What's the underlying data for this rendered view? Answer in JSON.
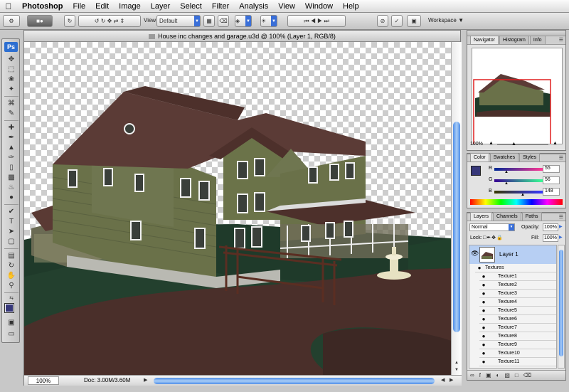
{
  "menubar": {
    "app_name": "Photoshop",
    "items": [
      "File",
      "Edit",
      "Image",
      "Layer",
      "Select",
      "Filter",
      "Analysis",
      "View",
      "Window",
      "Help"
    ]
  },
  "options_bar": {
    "view_label": "View:",
    "view_value": "Default",
    "workspace_label": "Workspace"
  },
  "tools": {
    "logo": "Ps",
    "foreground_color": "#37387a"
  },
  "document": {
    "title": "House inc changes and garage.u3d @ 100% (Layer 1, RGB/8)",
    "zoom": "100%",
    "doc_size": "Doc: 3.00M/3.60M"
  },
  "navigator": {
    "tabs": [
      "Navigator",
      "Histogram",
      "Info"
    ],
    "zoom": "100%"
  },
  "color_panel": {
    "tabs": [
      "Color",
      "Swatches",
      "Styles"
    ],
    "channels": [
      {
        "label": "R",
        "value": "55",
        "fraction": 0.216
      },
      {
        "label": "G",
        "value": "56",
        "fraction": 0.22
      },
      {
        "label": "B",
        "value": "148",
        "fraction": 0.58
      }
    ],
    "swatch": "#37387a"
  },
  "layers_panel": {
    "tabs": [
      "Layers",
      "Channels",
      "Paths"
    ],
    "blend_mode": "Normal",
    "opacity_label": "Opacity:",
    "opacity_value": "100%",
    "lock_label": "Lock:",
    "fill_label": "Fill:",
    "fill_value": "100%",
    "layer_name": "Layer 1",
    "group_name": "Textures",
    "textures": [
      "Texture1",
      "Texture2",
      "Texture3",
      "Texture4",
      "Texture5",
      "Texture6",
      "Texture7",
      "Texture8",
      "Texture9",
      "Texture10",
      "Texture11"
    ]
  }
}
